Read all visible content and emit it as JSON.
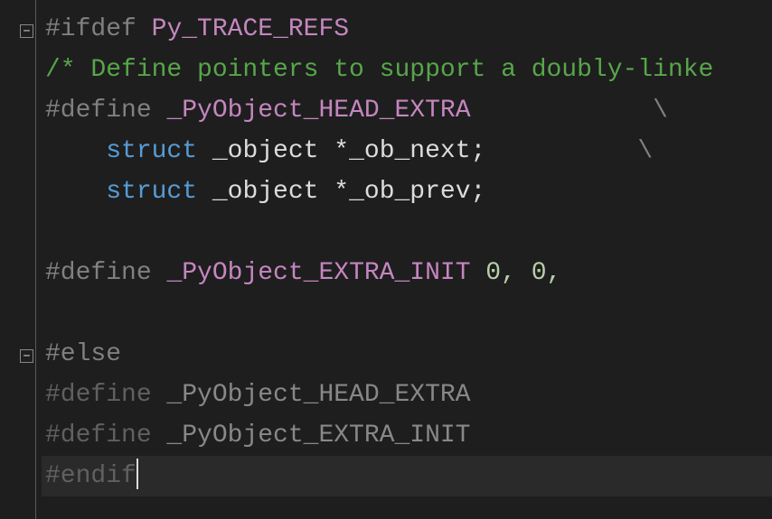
{
  "code": {
    "line1": {
      "directive": "#ifdef",
      "macro": "Py_TRACE_REFS"
    },
    "line2": {
      "comment": "/* Define pointers to support a doubly-linke"
    },
    "line3": {
      "directive": "#define",
      "macro": "_PyObject_HEAD_EXTRA",
      "cont": "\\"
    },
    "line4": {
      "keyword": "struct",
      "ident": " _object ",
      "star": "*",
      "name": "_ob_next",
      "semi": ";",
      "cont": "\\"
    },
    "line5": {
      "keyword": "struct",
      "ident": " _object ",
      "star": "*",
      "name": "_ob_prev",
      "semi": ";"
    },
    "line7": {
      "directive": "#define",
      "macro": "_PyObject_EXTRA_INIT",
      "vals": " 0, 0,"
    },
    "line9": {
      "directive": "#else"
    },
    "line10": {
      "directive": "#define ",
      "macro": "_PyObject_HEAD_EXTRA"
    },
    "line11": {
      "directive": "#define ",
      "macro": "_PyObject_EXTRA_INIT"
    },
    "line12": {
      "directive": "#endif"
    }
  }
}
